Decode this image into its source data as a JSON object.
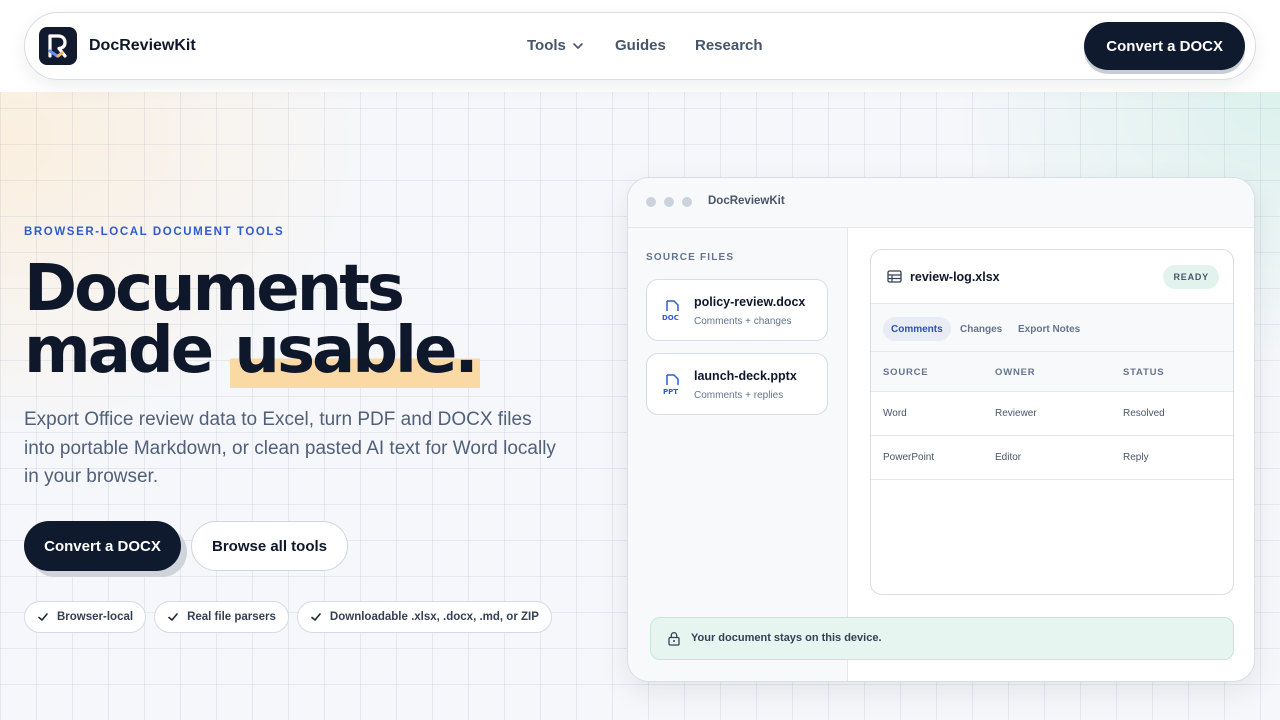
{
  "brand": {
    "name": "DocReviewKit"
  },
  "nav": {
    "tools": "Tools",
    "guides": "Guides",
    "research": "Research",
    "cta": "Convert a DOCX"
  },
  "hero": {
    "eyebrow": "BROWSER-LOCAL DOCUMENT TOOLS",
    "title_line1": "Documents",
    "title_line2_a": "made ",
    "title_line2_b": "usable.",
    "lede": "Export Office review data to Excel, turn PDF and DOCX files into portable Markdown, or clean pasted AI text for Word locally in your browser.",
    "primary_button": "Convert a DOCX",
    "secondary_button": "Browse all tools",
    "chips": [
      "Browser-local",
      "Real file parsers",
      "Downloadable .xlsx, .docx, .md, or ZIP"
    ]
  },
  "app": {
    "title": "DocReviewKit",
    "source_label": "SOURCE FILES",
    "files": [
      {
        "badge": "DOC",
        "name": "policy-review.docx",
        "sub": "Comments + changes"
      },
      {
        "badge": "PPT",
        "name": "launch-deck.pptx",
        "sub": "Comments + replies"
      }
    ],
    "panel": {
      "file": "review-log.xlsx",
      "status": "READY",
      "tabs": [
        "Comments",
        "Changes",
        "Export Notes"
      ],
      "columns": [
        "SOURCE",
        "OWNER",
        "STATUS"
      ],
      "rows": [
        [
          "Word",
          "Reviewer",
          "Resolved"
        ],
        [
          "PowerPoint",
          "Editor",
          "Reply"
        ]
      ]
    },
    "footer": "Your document stays on this device."
  },
  "colors": {
    "accent_blue": "#2f5bd0",
    "dark": "#0f1a2e",
    "highlight": "#fbd9a5",
    "ready_bg": "#e2f3ee",
    "note_bg": "#e7f5f0"
  }
}
